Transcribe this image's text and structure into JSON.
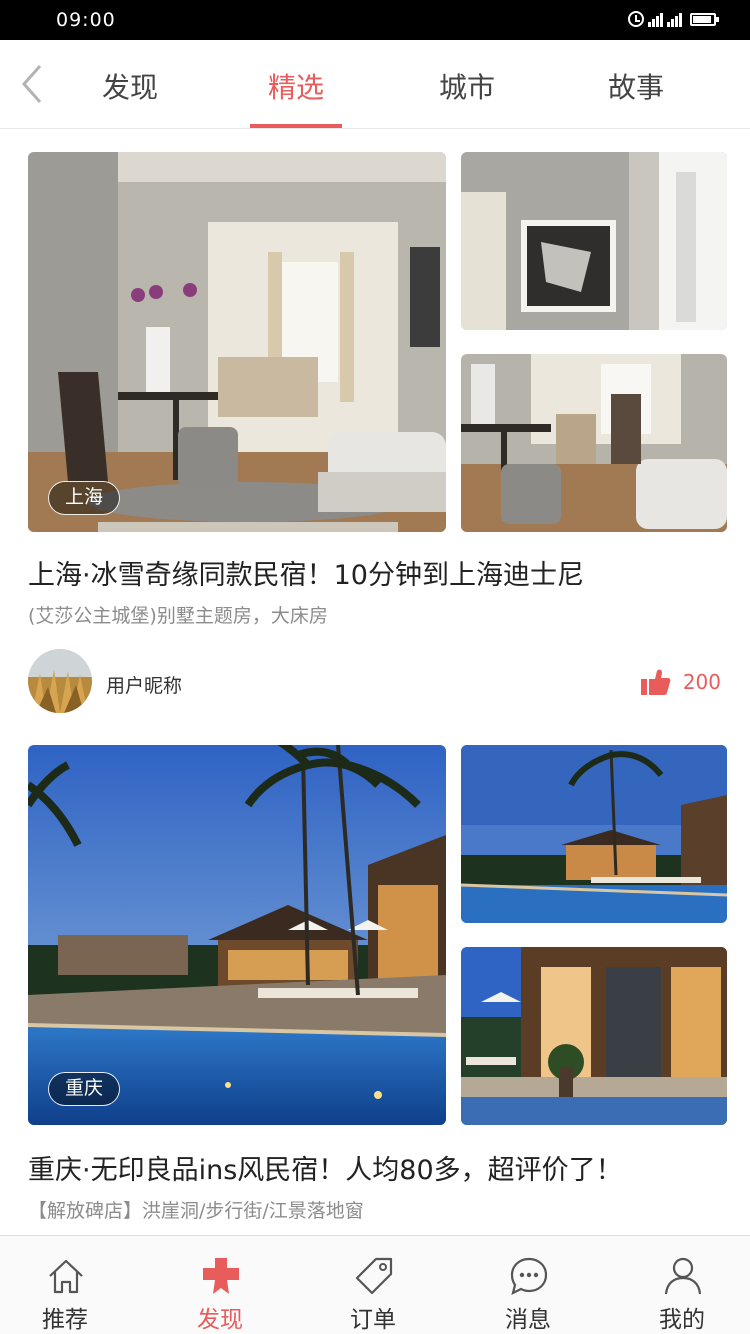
{
  "status_bar": {
    "time": "09:00"
  },
  "tabs": [
    {
      "label": "发现"
    },
    {
      "label": "精选"
    },
    {
      "label": "城市"
    },
    {
      "label": "故事"
    }
  ],
  "active_tab": "精选",
  "cards": [
    {
      "city": "上海",
      "title": "上海·冰雪奇缘同款民宿！10分钟到上海迪士尼",
      "subtitle": "(艾莎公主城堡)别墅主题房，大床房",
      "author": "用户昵称",
      "likes": "200"
    },
    {
      "city": "重庆",
      "title": "重庆·无印良品ins风民宿！人均80多，超评价了！",
      "subtitle": "【解放碑店】洪崖洞/步行街/江景落地窗"
    }
  ],
  "bottom_nav": [
    {
      "label": "推荐",
      "icon": "home-icon"
    },
    {
      "label": "发现",
      "icon": "discover-icon"
    },
    {
      "label": "订单",
      "icon": "tag-icon"
    },
    {
      "label": "消息",
      "icon": "message-icon"
    },
    {
      "label": "我的",
      "icon": "user-icon"
    }
  ],
  "colors": {
    "accent": "#e85c5c",
    "text": "#222222",
    "muted": "#8c8c8c"
  }
}
